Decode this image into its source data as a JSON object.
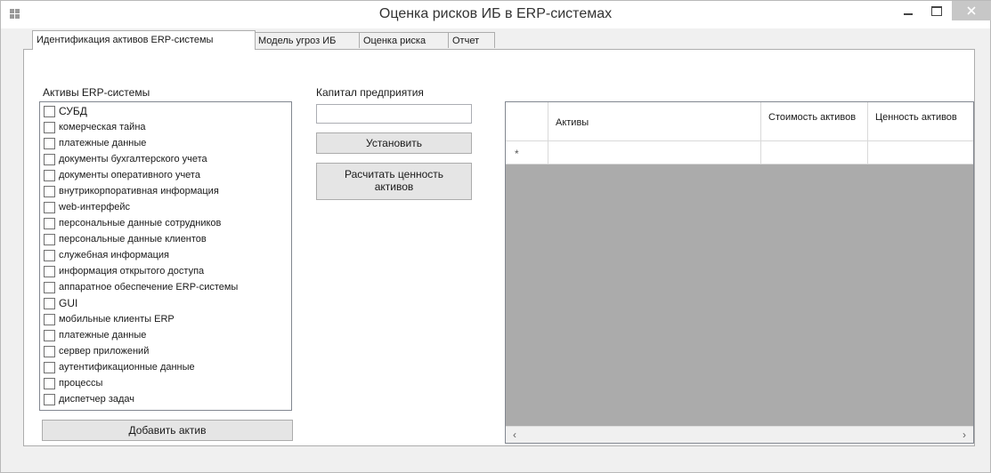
{
  "window": {
    "title": "Оценка рисков ИБ в ERP-системах"
  },
  "tabs": [
    {
      "label": "Идентификация активов ERP-системы",
      "active": true
    },
    {
      "label": "Модель угроз ИБ",
      "active": false
    },
    {
      "label": "Оценка риска",
      "active": false
    },
    {
      "label": "Отчет",
      "active": false
    }
  ],
  "assets_panel": {
    "label": "Активы ERP-системы",
    "items": [
      {
        "label": "СУБД",
        "checked": false
      },
      {
        "label": "комерческая тайна",
        "checked": false
      },
      {
        "label": "платежные данные",
        "checked": false
      },
      {
        "label": "документы бухгалтерского учета",
        "checked": false
      },
      {
        "label": "документы оперативного учета",
        "checked": false
      },
      {
        "label": "внутрикорпоративная информация",
        "checked": false
      },
      {
        "label": "web-интерфейс",
        "checked": false
      },
      {
        "label": "персональные данные сотрудников",
        "checked": false
      },
      {
        "label": "персональные данные клиентов",
        "checked": false
      },
      {
        "label": "служебная информация",
        "checked": false
      },
      {
        "label": "информация открытого доступа",
        "checked": false
      },
      {
        "label": "аппаратное обеспечение ERP-системы",
        "checked": false
      },
      {
        "label": "GUI",
        "checked": false
      },
      {
        "label": "мобильные клиенты ERP",
        "checked": false
      },
      {
        "label": "платежные данные",
        "checked": false
      },
      {
        "label": "сервер приложений",
        "checked": false
      },
      {
        "label": "аутентификационные данные",
        "checked": false
      },
      {
        "label": "процессы",
        "checked": false
      },
      {
        "label": "диспетчер задач",
        "checked": false
      }
    ],
    "add_button": "Добавить актив"
  },
  "capital": {
    "label": "Капитал предприятия",
    "value": "",
    "set_button": "Установить",
    "calc_button_line1": "Расчитать ценность",
    "calc_button_line2": "активов"
  },
  "grid": {
    "columns": [
      {
        "label": "Активы"
      },
      {
        "label": "Стоимость активов"
      },
      {
        "label": "Ценность активов"
      }
    ],
    "new_row_marker": "*",
    "scroll_left": "‹",
    "scroll_right": "›"
  }
}
